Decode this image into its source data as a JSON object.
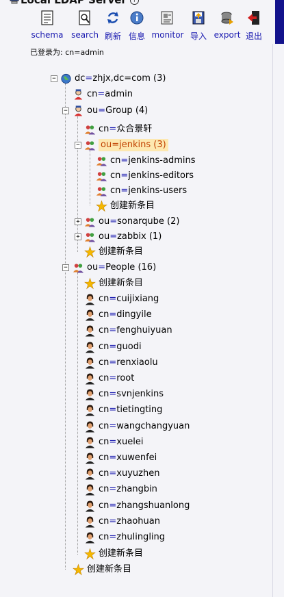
{
  "window": {
    "title": "Local LDAP Server"
  },
  "toolbar": {
    "items": [
      {
        "label": "schema",
        "icon": "schema-icon"
      },
      {
        "label": "search",
        "icon": "search-icon"
      },
      {
        "label": "刷新",
        "icon": "refresh-icon"
      },
      {
        "label": "信息",
        "icon": "info-icon"
      },
      {
        "label": "monitor",
        "icon": "monitor-icon"
      },
      {
        "label": "导入",
        "icon": "import-icon"
      },
      {
        "label": "export",
        "icon": "export-icon"
      },
      {
        "label": "退出",
        "icon": "logout-icon"
      }
    ]
  },
  "login": {
    "text": "已登录为: cn=admin"
  },
  "tree": {
    "root": {
      "attr": "dc",
      "value": "zhjx,dc=com",
      "count": "(3)"
    },
    "admin": {
      "attr": "cn",
      "value": "admin"
    },
    "group": {
      "attr": "ou",
      "value": "Group",
      "count": "(4)"
    },
    "group_children": [
      {
        "attr": "cn",
        "value": "众合景轩"
      }
    ],
    "jenkins": {
      "attr": "ou",
      "value": "jenkins",
      "count": "(3)"
    },
    "jenkins_children": [
      {
        "attr": "cn",
        "value": "jenkins-admins"
      },
      {
        "attr": "cn",
        "value": "jenkins-editors"
      },
      {
        "attr": "cn",
        "value": "jenkins-users"
      }
    ],
    "sonarqube": {
      "attr": "ou",
      "value": "sonarqube",
      "count": "(2)"
    },
    "zabbix": {
      "attr": "ou",
      "value": "zabbix",
      "count": "(1)"
    },
    "people": {
      "attr": "ou",
      "value": "People",
      "count": "(16)"
    },
    "people_children": [
      {
        "attr": "cn",
        "value": "cuijixiang"
      },
      {
        "attr": "cn",
        "value": "dingyile"
      },
      {
        "attr": "cn",
        "value": "fenghuiyuan"
      },
      {
        "attr": "cn",
        "value": "guodi"
      },
      {
        "attr": "cn",
        "value": "renxiaolu"
      },
      {
        "attr": "cn",
        "value": "root"
      },
      {
        "attr": "cn",
        "value": "svnjenkins"
      },
      {
        "attr": "cn",
        "value": "tietingting"
      },
      {
        "attr": "cn",
        "value": "wangchangyuan"
      },
      {
        "attr": "cn",
        "value": "xuelei"
      },
      {
        "attr": "cn",
        "value": "xuwenfei"
      },
      {
        "attr": "cn",
        "value": "xuyuzhen"
      },
      {
        "attr": "cn",
        "value": "zhangbin"
      },
      {
        "attr": "cn",
        "value": "zhangshuanlong"
      },
      {
        "attr": "cn",
        "value": "zhaohuan"
      },
      {
        "attr": "cn",
        "value": "zhulingling"
      }
    ],
    "create_new": "创建新条目"
  },
  "colors": {
    "link": "#1a1ab0",
    "selected_bg": "#fde8b0",
    "selected_text": "#c04000",
    "accent_bar": "#12128c"
  }
}
